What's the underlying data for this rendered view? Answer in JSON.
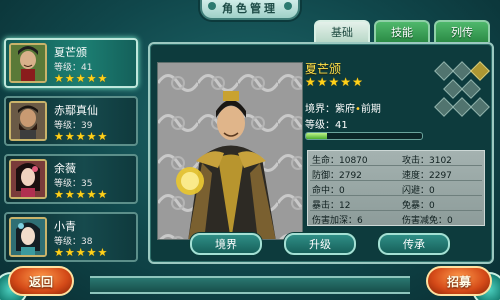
{
  "title": "角色管理",
  "roster": [
    {
      "name": "夏芒颁",
      "level_label": "等级：41",
      "stars": 5,
      "active": true
    },
    {
      "name": "赤鄢真仙",
      "level_label": "等级：39",
      "stars": 5,
      "active": false
    },
    {
      "name": "余薇",
      "level_label": "等级：35",
      "stars": 5,
      "active": false
    },
    {
      "name": "小青",
      "level_label": "等级：38",
      "stars": 5,
      "active": false
    }
  ],
  "tabs": [
    "基础",
    "技能",
    "列传"
  ],
  "hero": {
    "name": "夏芒颁",
    "stars": 5,
    "realm_prefix": "境界：紫府",
    "realm_dot": "•",
    "realm_suffix": "前期",
    "level_label": "等级：41",
    "exp_progress": 0.18
  },
  "stats": {
    "hp": "生命：10870",
    "attack": "攻击：3102",
    "defense": "防御：2792",
    "speed": "速度：2297",
    "hit": "命中：0",
    "dodge": "闪避：0",
    "crit": "暴击：12",
    "anti_crit": "免暴：0",
    "dmg_up": "伤害加深：6",
    "dmg_down": "伤害减免：0"
  },
  "actions": {
    "realm": "境界",
    "upgrade": "升级",
    "inherit": "传承"
  },
  "footer": {
    "back": "返回",
    "recruit": "招募"
  },
  "colors": {
    "star": "#ffd21a",
    "hero_name": "#ffe14a",
    "accent": "#1c7e72"
  }
}
